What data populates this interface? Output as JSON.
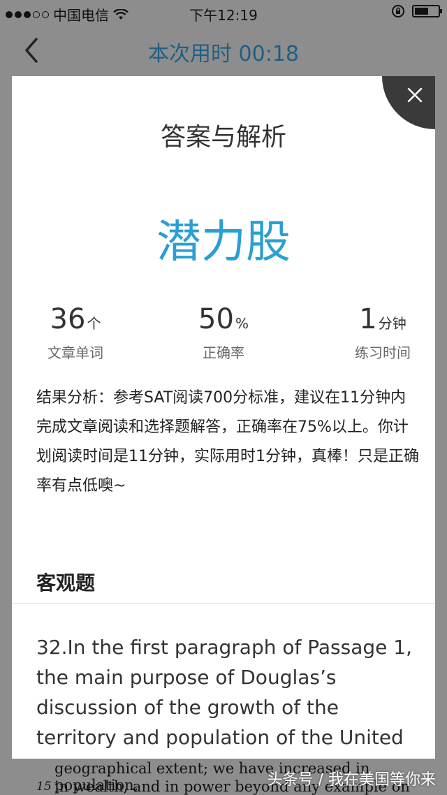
{
  "status_bar": {
    "carrier": "中国电信",
    "time": "下午12:19",
    "battery_level": 0.6
  },
  "nav": {
    "title": "本次用时 00:18"
  },
  "modal": {
    "title": "答案与解析",
    "word": "潜力股",
    "stats": {
      "words": {
        "value": "36",
        "unit": "个",
        "label": "文章单词"
      },
      "accuracy": {
        "value": "50",
        "unit": "%",
        "label": "正确率"
      },
      "practice_time": {
        "value": "1",
        "unit": "分钟",
        "label": "练习时间"
      }
    },
    "analysis": "结果分析：参考SAT阅读700分标准，建议在11分钟内完成文章阅读和选择题解答，正确率在75%以上。你计划阅读时间是11分钟，实际用时1分钟，真棒！只是正确率有点低噢~",
    "section_title": "客观题",
    "question": "32.In the first paragraph of Passage 1, the main purpose of Douglas’s discussion of the growth of the territory and population of the United"
  },
  "background": {
    "line1": "geographical extent; we have increased in population,",
    "line_number": "15",
    "line2": "in wealth, and in power beyond any example on"
  },
  "watermark": "头条号 / 我在美国等你来",
  "colors": {
    "accent": "#2a9fd3",
    "nav_title": "#1f5f86",
    "overlay": "#8d8d8d"
  }
}
